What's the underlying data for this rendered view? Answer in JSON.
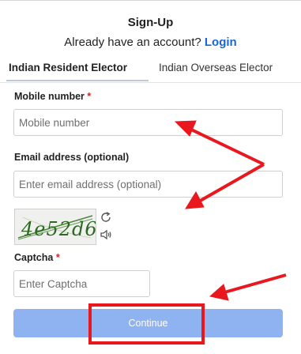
{
  "header": {
    "title": "Sign-Up",
    "subtitle_prefix": "Already have an account?",
    "login_link": "Login"
  },
  "tabs": [
    {
      "label": "Indian Resident Elector",
      "active": true
    },
    {
      "label": "Indian Overseas Elector",
      "active": false
    }
  ],
  "form": {
    "mobile": {
      "label": "Mobile number",
      "required": "*",
      "placeholder": "Mobile number"
    },
    "email": {
      "label": "Email address (optional)",
      "placeholder": "Enter email address (optional)"
    },
    "captcha_image": {
      "text": "4e52d6"
    },
    "captcha": {
      "label": "Captcha",
      "required": "*",
      "placeholder": "Enter Captcha"
    },
    "submit_label": "Continue"
  },
  "icons": {
    "refresh": "refresh-icon",
    "audio": "speaker-icon"
  },
  "colors": {
    "accent": "#1a66d6",
    "button": "#8fb3f0",
    "required": "#d32424",
    "annotation": "#e8181e"
  }
}
